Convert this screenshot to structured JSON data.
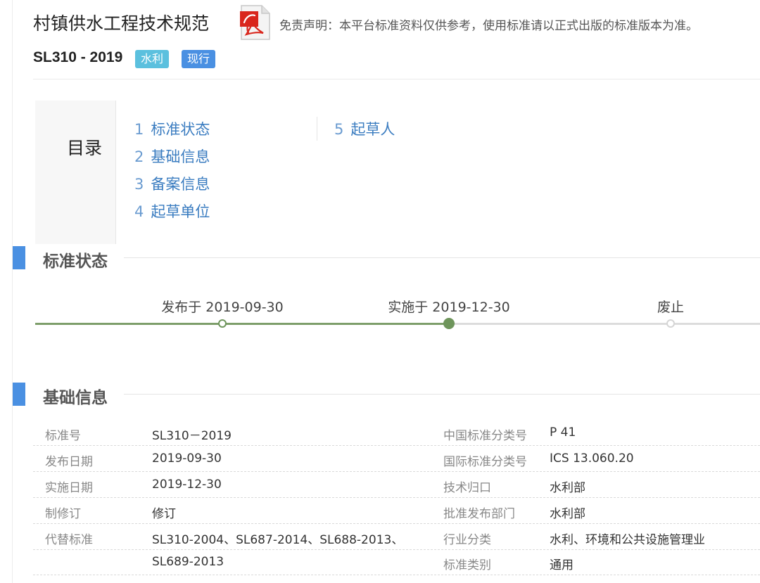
{
  "header": {
    "title": "村镇供水工程技术规范",
    "disclaimer": "免责声明：本平台标准资料仅供参考，使用标准请以正式出版的标准版本为准。",
    "code": "SL310 - 2019",
    "badges": {
      "field": "水利",
      "status": "现行"
    }
  },
  "toc": {
    "label": "目录",
    "items": [
      {
        "num": "1",
        "label": "标准状态"
      },
      {
        "num": "2",
        "label": "基础信息"
      },
      {
        "num": "3",
        "label": "备案信息"
      },
      {
        "num": "4",
        "label": "起草单位"
      },
      {
        "num": "5",
        "label": "起草人"
      }
    ]
  },
  "status_section": {
    "title": "标准状态",
    "events": {
      "published": "发布于 2019-09-30",
      "effective": "实施于 2019-12-30",
      "abolished": "废止"
    }
  },
  "basic_section": {
    "title": "基础信息",
    "rows": [
      [
        "标准号",
        "SL310－2019",
        "中国标准分类号",
        "P 41"
      ],
      [
        "发布日期",
        "2019-09-30",
        "国际标准分类号",
        "ICS 13.060.20"
      ],
      [
        "实施日期",
        "2019-12-30",
        "技术归口",
        "水利部"
      ],
      [
        "制修订",
        "修订",
        "批准发布部门",
        "水利部"
      ],
      [
        "代替标准",
        "SL310-2004、SL687-2014、SL688-2013、",
        "行业分类",
        "水利、环境和公共设施管理业"
      ],
      [
        "",
        "SL689-2013",
        "标准类别",
        "通用"
      ]
    ]
  },
  "icons": {
    "pdf": "pdf-file-icon"
  },
  "colors": {
    "badge_field": "#5bc0de",
    "badge_status": "#4a90e2",
    "section_accent": "#4a90e2",
    "toc_link": "#3a7cc0",
    "timeline_done": "#7d9e6a",
    "timeline_todo": "#dcdcdc"
  }
}
